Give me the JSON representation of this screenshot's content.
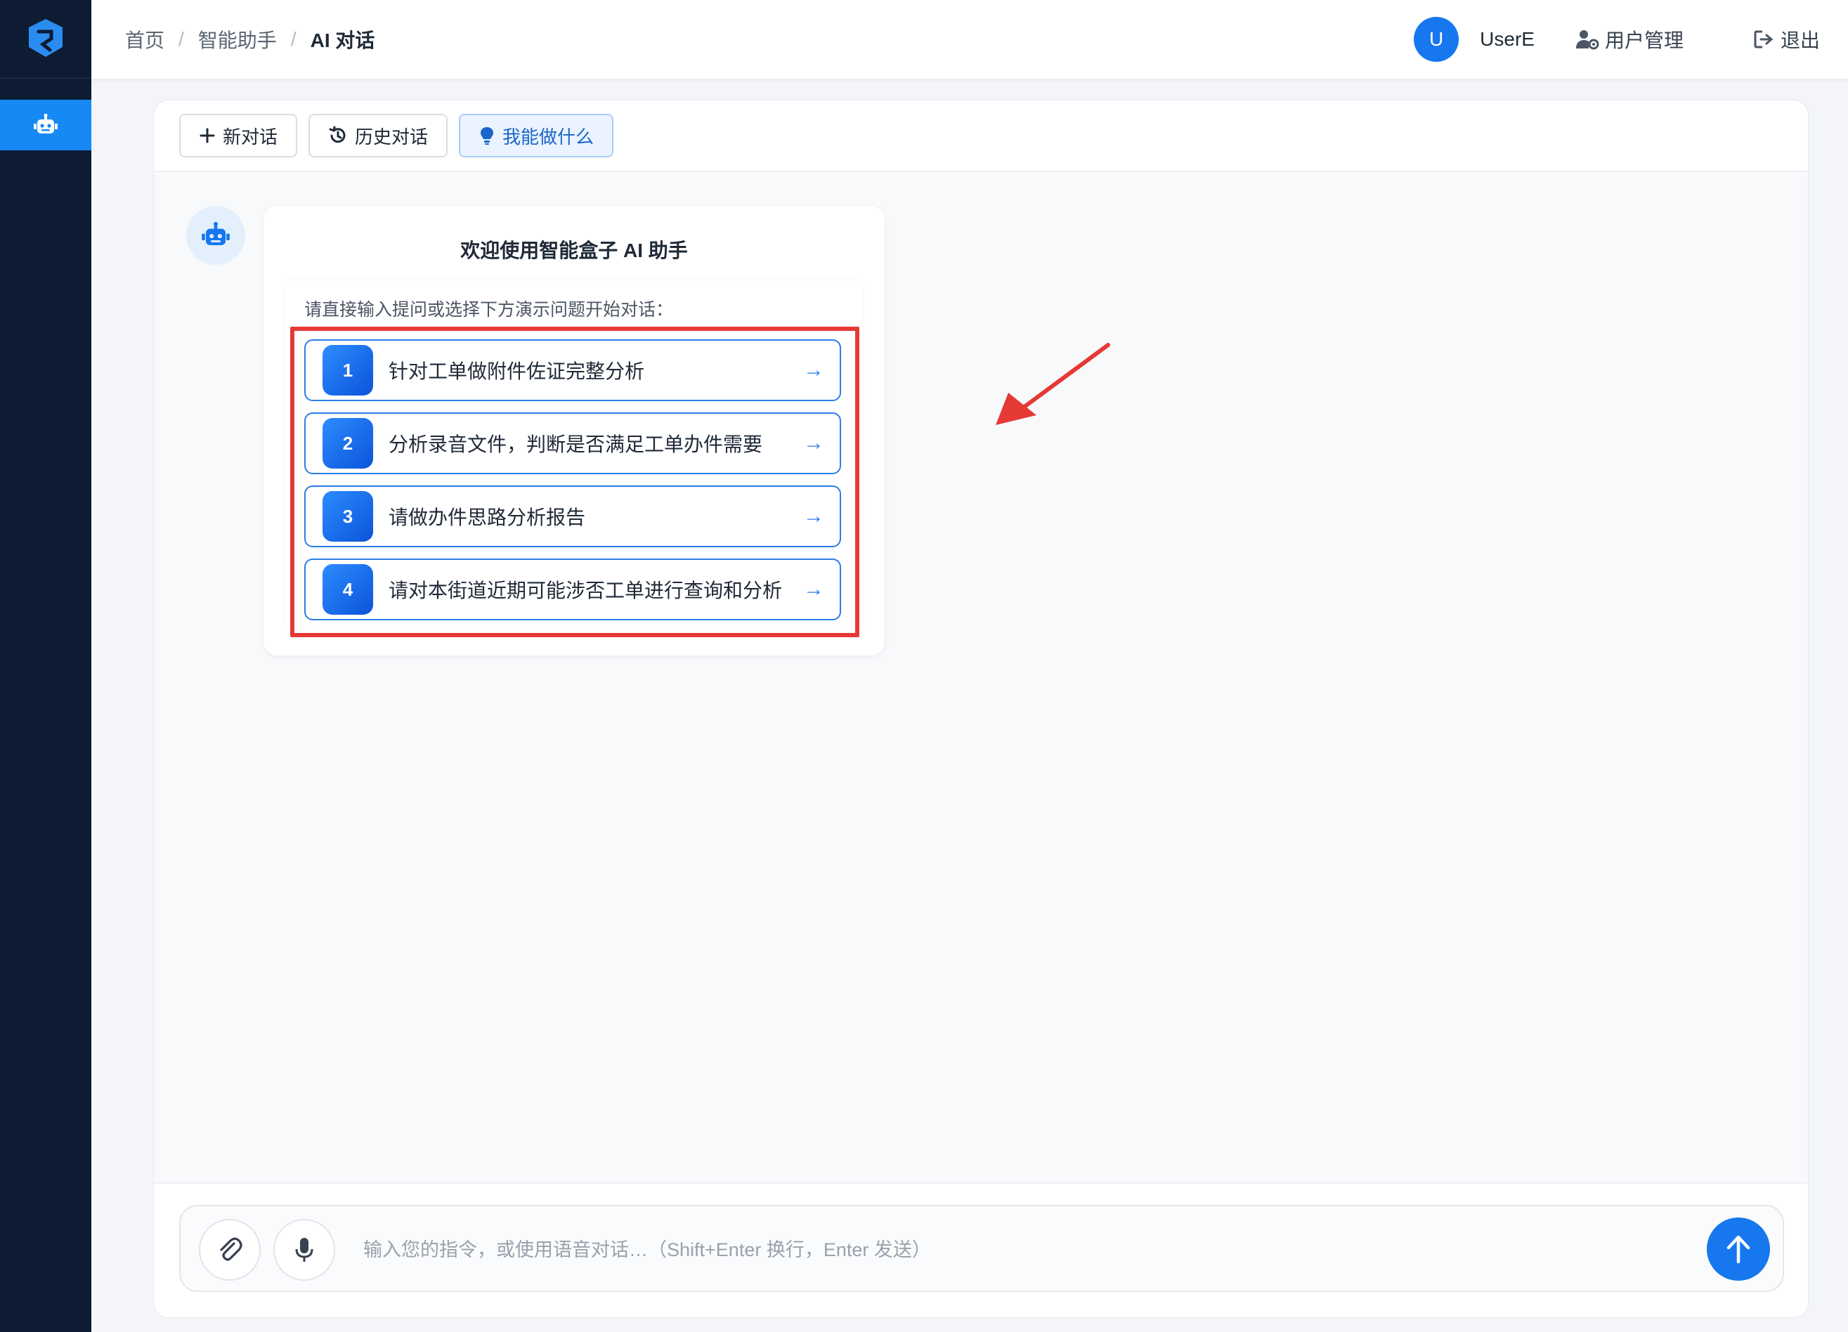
{
  "breadcrumb": {
    "home": "首页",
    "section": "智能助手",
    "current": "AI 对话"
  },
  "user": {
    "avatar_letter": "U",
    "name": "UserE"
  },
  "header_links": {
    "user_management": "用户管理",
    "logout": "退出"
  },
  "toolbar": {
    "new_chat": "新对话",
    "history": "历史对话",
    "capabilities": "我能做什么"
  },
  "welcome": {
    "title": "欢迎使用智能盒子 AI 助手",
    "hint": "请直接输入提问或选择下方演示问题开始对话："
  },
  "suggestions": [
    {
      "num": "1",
      "text": "针对工单做附件佐证完整分析",
      "arrow": "→"
    },
    {
      "num": "2",
      "text": "分析录音文件，判断是否满足工单办件需要",
      "arrow": "→"
    },
    {
      "num": "3",
      "text": "请做办件思路分析报告",
      "arrow": "→"
    },
    {
      "num": "4",
      "text": "请对本街道近期可能涉否工单进行查询和分析",
      "arrow": "→"
    }
  ],
  "input": {
    "placeholder": "输入您的指令，或使用语音对话…（Shift+Enter 换行，Enter 发送）"
  },
  "colors": {
    "sidebar": "#0d1b33",
    "accent": "#1677ef",
    "highlight": "#e53935"
  },
  "icons": {
    "logo": "app-logo-icon",
    "nav": "robot-icon",
    "new": "plus-icon",
    "history": "history-icon",
    "capabilities": "lightbulb-icon",
    "attach": "paperclip-icon",
    "voice": "microphone-icon",
    "send": "arrow-up-icon",
    "logout": "logout-icon",
    "user_mgmt": "user-gear-icon"
  }
}
